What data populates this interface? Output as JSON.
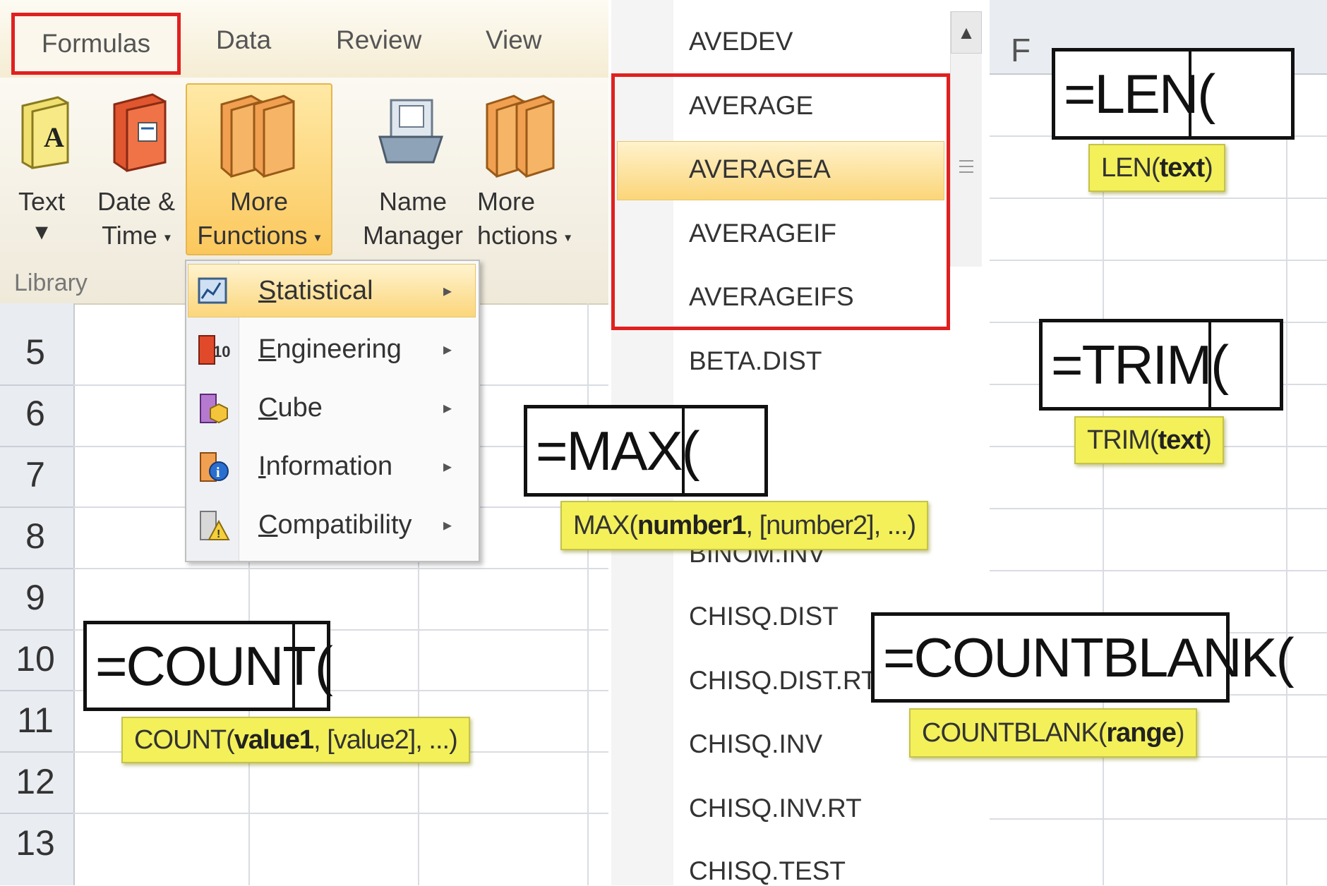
{
  "ribbon": {
    "tabs": [
      "Formulas",
      "Data",
      "Review",
      "View"
    ],
    "buttons": {
      "text": {
        "line1": "Text",
        "caret": "▾"
      },
      "date_time": {
        "line1": "Date &",
        "line2": "Time",
        "caret": "▾"
      },
      "more_functions": {
        "line1": "More",
        "line2": "Functions",
        "caret": "▾"
      },
      "name_manager": {
        "line1": "Name",
        "line2": "Manager"
      },
      "more_functions_2": {
        "line1": "More",
        "line2": "hctions",
        "caret": "▾"
      }
    },
    "group_label": "Library"
  },
  "menu": {
    "items": [
      {
        "label": "Statistical",
        "underline": "S",
        "rest": "tatistical",
        "arrow": "▸"
      },
      {
        "label": "Engineering",
        "underline": "E",
        "rest": "ngineering",
        "arrow": "▸"
      },
      {
        "label": "Cube",
        "underline": "C",
        "rest": "ube",
        "arrow": "▸"
      },
      {
        "label": "Information",
        "underline": "I",
        "rest": "nformation",
        "arrow": "▸"
      },
      {
        "label": "Compatibility",
        "underline": "C",
        "rest": "ompatibility",
        "arrow": "▸"
      }
    ]
  },
  "rows": [
    "5",
    "6",
    "7",
    "8",
    "9",
    "10",
    "11",
    "12",
    "13"
  ],
  "function_list": [
    "AVEDEV",
    "AVERAGE",
    "AVERAGEA",
    "AVERAGEIF",
    "AVERAGEIFS",
    "BETA.DIST",
    "BINOM.INV",
    "CHISQ.DIST",
    "CHISQ.DIST.RT",
    "CHISQ.INV",
    "CHISQ.INV.RT",
    "CHISQ.TEST"
  ],
  "scroll_up": "▲",
  "column_header": "F",
  "formulas": {
    "count": {
      "text": "=COUNT(",
      "tip_name": "COUNT(",
      "tip_bold": "value1",
      "tip_rest": ", [value2], ...)"
    },
    "max": {
      "text": "=MAX(",
      "tip_name": "MAX(",
      "tip_bold": "number1",
      "tip_rest": ", [number2], ...)"
    },
    "len": {
      "text": "=LEN(",
      "tip_name": "LEN(",
      "tip_bold": "text",
      "tip_rest": ")"
    },
    "trim": {
      "text": "=TRIM(",
      "tip_name": "TRIM(",
      "tip_bold": "text",
      "tip_rest": ")"
    },
    "countblank": {
      "text": "=COUNTBLANK(",
      "tip_name": "COUNTBLANK(",
      "tip_bold": "range",
      "tip_rest": ")"
    }
  },
  "colors": {
    "highlight": "#fbd67b",
    "red_outline": "#e02020",
    "tooltip": "#f3f05a"
  }
}
